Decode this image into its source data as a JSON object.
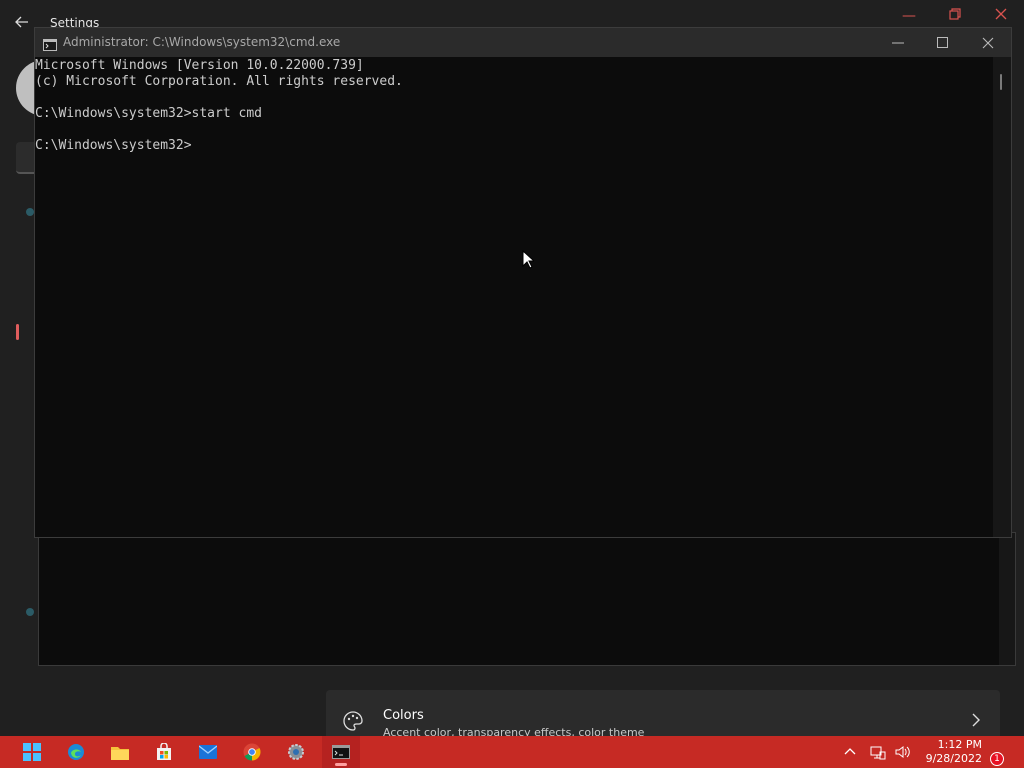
{
  "settings_window": {
    "title": "Settings",
    "colors_card": {
      "title": "Colors",
      "subtitle": "Accent color, transparency effects, color theme"
    }
  },
  "cmd_window": {
    "title": "Administrator: C:\\Windows\\system32\\cmd.exe",
    "lines": [
      "Microsoft Windows [Version 10.0.22000.739]",
      "(c) Microsoft Corporation. All rights reserved.",
      "",
      "C:\\Windows\\system32>start cmd",
      "",
      "C:\\Windows\\system32>"
    ]
  },
  "taskbar": {
    "apps": [
      "start-icon",
      "edge-icon",
      "file-explorer-icon",
      "store-icon",
      "mail-icon",
      "chrome-icon",
      "settings-icon",
      "terminal-icon"
    ],
    "clock_time": "1:12 PM",
    "clock_date": "9/28/2022",
    "notification_count": "1"
  },
  "colors": {
    "taskbar": "#c62a24",
    "console_bg": "#0c0c0c",
    "console_text": "#cccccc"
  }
}
